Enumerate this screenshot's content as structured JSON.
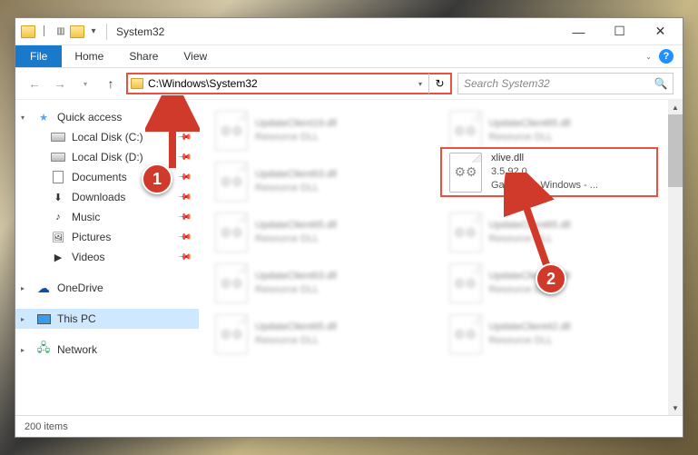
{
  "window": {
    "title": "System32",
    "controls": {
      "min": "—",
      "max": "☐",
      "close": "✕"
    }
  },
  "ribbon": {
    "file": "File",
    "tabs": [
      "Home",
      "Share",
      "View"
    ]
  },
  "nav": {
    "path": "C:\\Windows\\System32",
    "search_placeholder": "Search System32"
  },
  "sidebar": {
    "quick_access": "Quick access",
    "items": [
      {
        "label": "Local Disk (C:)",
        "icon": "drive"
      },
      {
        "label": "Local Disk (D:)",
        "icon": "drive"
      },
      {
        "label": "Documents",
        "icon": "doc"
      },
      {
        "label": "Downloads",
        "icon": "folder"
      },
      {
        "label": "Music",
        "icon": "folder"
      },
      {
        "label": "Pictures",
        "icon": "folder"
      },
      {
        "label": "Videos",
        "icon": "folder"
      }
    ],
    "onedrive": "OneDrive",
    "thispc": "This PC",
    "network": "Network"
  },
  "files_blur": [
    {
      "name": "UpdateClient19.dll",
      "desc": "Resource DLL"
    },
    {
      "name": "UpdateClient65.dll",
      "desc": "Resource DLL"
    },
    {
      "name": "UpdateClient63.dll",
      "desc": "Resource DLL"
    },
    {
      "name": "",
      "desc": ""
    },
    {
      "name": "UpdateClient65.dll",
      "desc": "Resource DLL"
    },
    {
      "name": "UpdateClient65.dll",
      "desc": "Resource DLL"
    },
    {
      "name": "UpdateClient63.dll",
      "desc": "Resource DLL"
    },
    {
      "name": "UpdateClient21.dll",
      "desc": "Resource DLL"
    },
    {
      "name": "UpdateClient65.dll",
      "desc": "Resource DLL"
    },
    {
      "name": "UpdateClient42.dll",
      "desc": "Resource DLL"
    }
  ],
  "highlight": {
    "name": "xlive.dll",
    "version": "3.5.92.0",
    "desc": "Games for Windows - ..."
  },
  "status": {
    "count": "200 items"
  },
  "callouts": {
    "one": "1",
    "two": "2"
  }
}
